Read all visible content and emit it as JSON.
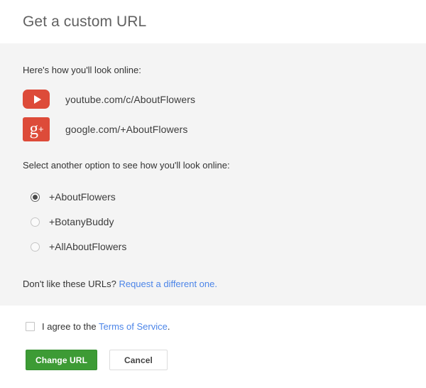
{
  "header": {
    "title": "Get a custom URL"
  },
  "body": {
    "intro_text": "Here's how you'll look online:",
    "urls": [
      {
        "icon": "youtube-icon",
        "text": "youtube.com/c/AboutFlowers"
      },
      {
        "icon": "google-plus-icon",
        "text": "google.com/+AboutFlowers"
      }
    ],
    "select_prompt": "Select another option to see how you'll look online:",
    "options": [
      {
        "label": "+AboutFlowers",
        "selected": true
      },
      {
        "label": "+BotanyBuddy",
        "selected": false
      },
      {
        "label": "+AllAboutFlowers",
        "selected": false
      }
    ],
    "request": {
      "text": "Don't like these URLs?",
      "link_text": "Request a different one."
    }
  },
  "footer": {
    "agree": {
      "checked": false,
      "text_before": "I agree to the",
      "link_text": "Terms of Service",
      "text_after": "."
    },
    "primary_button": "Change URL",
    "secondary_button": "Cancel"
  },
  "colors": {
    "brand_red": "#dd4b39",
    "primary_green": "#3d9b35",
    "link_blue": "#4c85e8",
    "panel_gray": "#f4f4f4"
  }
}
